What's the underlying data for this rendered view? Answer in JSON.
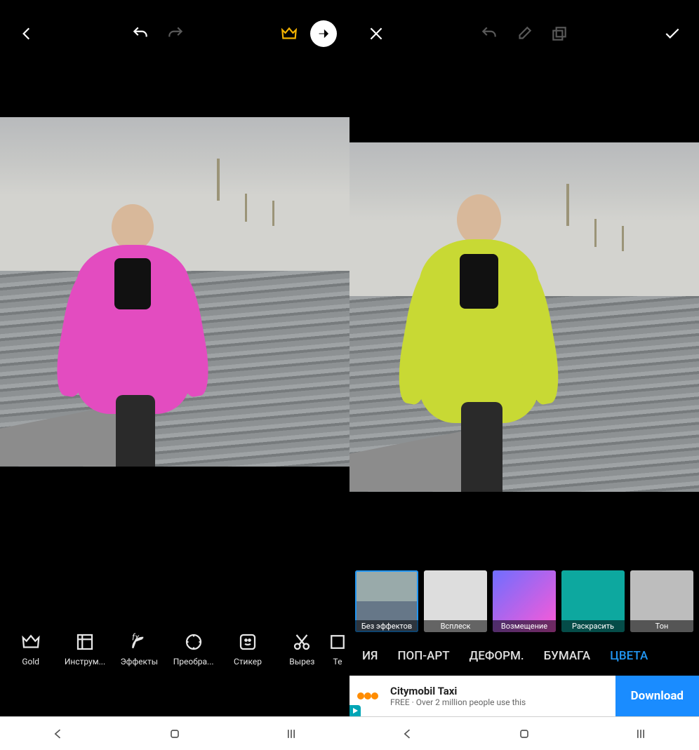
{
  "left": {
    "toolbar": [
      {
        "label": "Gold"
      },
      {
        "label": "Инструм..."
      },
      {
        "label": "Эффекты"
      },
      {
        "label": "Преобра..."
      },
      {
        "label": "Стикер"
      },
      {
        "label": "Вырез"
      },
      {
        "label": "Те"
      }
    ]
  },
  "right": {
    "fx": [
      {
        "label": "Без эффектов",
        "selected": true
      },
      {
        "label": "Всплеск"
      },
      {
        "label": "Возмещение"
      },
      {
        "label": "Раскрасить"
      },
      {
        "label": "Тон"
      }
    ],
    "categories": [
      {
        "label": "ИЯ"
      },
      {
        "label": "ПОП-АРТ"
      },
      {
        "label": "ДЕФОРМ."
      },
      {
        "label": "БУМАГА"
      },
      {
        "label": "ЦВЕТА",
        "active": true
      }
    ],
    "ad": {
      "title": "Citymobil Taxi",
      "subtitle": "FREE · Over 2 million people use this",
      "cta": "Download"
    }
  }
}
